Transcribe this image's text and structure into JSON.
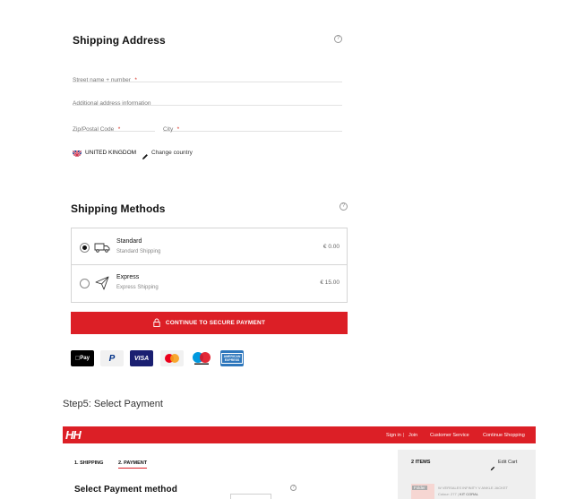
{
  "shipping_address": {
    "title": "Shipping Address",
    "help": "?",
    "street_label": "Street name + number",
    "additional_label": "Additional address information",
    "zip_label": "Zip/Postal Code",
    "city_label": "City",
    "required_mark": "*",
    "country": "UNITED KINGDOM",
    "change_country": "Change country"
  },
  "shipping_methods": {
    "title": "Shipping Methods",
    "help": "?",
    "options": [
      {
        "name": "Standard",
        "sub": "Standard Shipping",
        "price": "€ 0.00",
        "selected": true
      },
      {
        "name": "Express",
        "sub": "Express Shipping",
        "price": "€ 15.00",
        "selected": false
      }
    ],
    "continue_label": "CONTINUE TO SECURE PAYMENT"
  },
  "payment_icons": {
    "applepay": "Pay",
    "paypal": "P",
    "visa": "VISA",
    "amex": "AMERICAN EXPRESS"
  },
  "caption": "Step5: Select Payment",
  "step5": {
    "logo": "HH",
    "nav": [
      "Sign in",
      "Join",
      "Customer Service",
      "Continue Shopping"
    ],
    "nav_sep": "|",
    "tabs": [
      "1. SHIPPING",
      "2. PAYMENT"
    ],
    "items_label": "2 ITEMS",
    "edit_cart": "Edit Cart",
    "title": "Select Payment method",
    "help": "?",
    "item_badge": "Folder",
    "item_name": "W VERSALES INFINITY V ANKLE JACKET",
    "item_color_prefix": "Colour: 277 |",
    "item_color": "KIT CORAL"
  },
  "colors": {
    "brand_red": "#dc1f26"
  }
}
